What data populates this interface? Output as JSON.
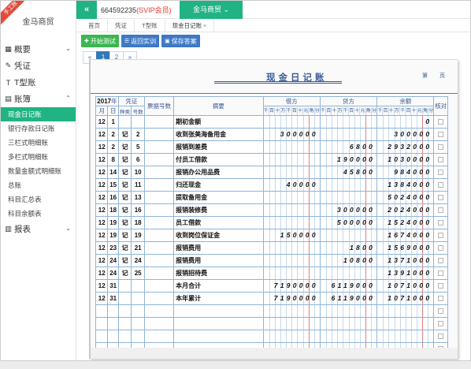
{
  "ribbon": "手工账",
  "sidebar": {
    "brand": "金马商贸",
    "groups": [
      {
        "label": "概要",
        "icon": "dashboard-icon"
      },
      {
        "label": "凭证",
        "icon": "pen-icon"
      },
      {
        "label": "T型账",
        "icon": "t-icon"
      },
      {
        "label": "账簿",
        "icon": "book-icon"
      }
    ],
    "items": [
      "现金日记账",
      "银行存款日记账",
      "三栏式明细账",
      "多栏式明细账",
      "数量金额式明细账",
      "总账",
      "科目汇总表",
      "科目余额表"
    ],
    "report": {
      "label": "报表",
      "icon": "table-icon"
    }
  },
  "topbar": {
    "collapse": "«",
    "user_id": "664592235",
    "vip": "(SVIP会员)",
    "company": "金马商贸"
  },
  "tabs": [
    {
      "label": "首页"
    },
    {
      "label": "凭证"
    },
    {
      "label": "T型账"
    },
    {
      "label": "现金日记账",
      "close": "×"
    }
  ],
  "toolbar": {
    "start": "开始测试",
    "back": "返回实训",
    "save": "保存答案"
  },
  "pager": {
    "prev": "«",
    "pages": [
      "1",
      "2"
    ],
    "next": "»"
  },
  "ledger": {
    "title": "现金日记账",
    "page_label_di": "第",
    "page_label_ye": "页",
    "header": {
      "year": "2017",
      "year_suffix": "年",
      "voucher": "凭证",
      "voucher_no": "票据号数",
      "summary": "摘要",
      "debit": "借方",
      "credit": "贷方",
      "balance": "余额",
      "check": "核对",
      "month": "月",
      "day": "日",
      "kind": "种类",
      "num": "号数",
      "digits": [
        "千",
        "百",
        "十",
        "万",
        "千",
        "百",
        "十",
        "元",
        "角",
        "分"
      ]
    },
    "rows": [
      {
        "m": "12",
        "d": "1",
        "k": "",
        "n": "",
        "summary": "期初金额",
        "debit": "",
        "credit": "",
        "balance": "0"
      },
      {
        "m": "12",
        "d": "2",
        "k": "记",
        "n": "2",
        "summary": "收到张美海备用金",
        "debit": "300000",
        "credit": "",
        "balance": "300000"
      },
      {
        "m": "12",
        "d": "2",
        "k": "记",
        "n": "5",
        "summary": "报销到差费",
        "debit": "",
        "credit": "6800",
        "balance": "2932000"
      },
      {
        "m": "12",
        "d": "8",
        "k": "记",
        "n": "6",
        "summary": "付员工借款",
        "debit": "",
        "credit": "190000",
        "balance": "1030000"
      },
      {
        "m": "12",
        "d": "14",
        "k": "记",
        "n": "10",
        "summary": "报销办公用品费",
        "debit": "",
        "credit": "45800",
        "balance": "984000"
      },
      {
        "m": "12",
        "d": "15",
        "k": "记",
        "n": "11",
        "summary": "归还现金",
        "debit": "40000",
        "credit": "",
        "balance": "1384000"
      },
      {
        "m": "12",
        "d": "16",
        "k": "记",
        "n": "13",
        "summary": "提取备用金",
        "debit": "",
        "credit": "",
        "balance": "5024000"
      },
      {
        "m": "12",
        "d": "18",
        "k": "记",
        "n": "16",
        "summary": "报销装修费",
        "debit": "",
        "credit": "300000",
        "balance": "2024000"
      },
      {
        "m": "12",
        "d": "19",
        "k": "记",
        "n": "18",
        "summary": "员工借款",
        "debit": "",
        "credit": "500000",
        "balance": "1524000"
      },
      {
        "m": "12",
        "d": "19",
        "k": "记",
        "n": "19",
        "summary": "收到岗位保证金",
        "debit": "150000",
        "credit": "",
        "balance": "1674000"
      },
      {
        "m": "12",
        "d": "23",
        "k": "记",
        "n": "21",
        "summary": "报销费用",
        "debit": "",
        "credit": "1800",
        "balance": "1569000"
      },
      {
        "m": "12",
        "d": "24",
        "k": "记",
        "n": "24",
        "summary": "报销费用",
        "debit": "",
        "credit": "10800",
        "balance": "1371000"
      },
      {
        "m": "12",
        "d": "24",
        "k": "记",
        "n": "25",
        "summary": "报销招待费",
        "debit": "",
        "credit": "",
        "balance": "1391000"
      },
      {
        "m": "12",
        "d": "31",
        "k": "",
        "n": "",
        "summary": "本月合计",
        "debit": "7190000",
        "credit": "6119000",
        "balance": "1071000"
      },
      {
        "m": "12",
        "d": "31",
        "k": "",
        "n": "",
        "summary": "本年累计",
        "debit": "7190000",
        "credit": "6119000",
        "balance": "1071000"
      },
      {
        "m": "",
        "d": "",
        "k": "",
        "n": "",
        "summary": "",
        "debit": "",
        "credit": "",
        "balance": ""
      },
      {
        "m": "",
        "d": "",
        "k": "",
        "n": "",
        "summary": "",
        "debit": "",
        "credit": "",
        "balance": ""
      },
      {
        "m": "",
        "d": "",
        "k": "",
        "n": "",
        "summary": "",
        "debit": "",
        "credit": "",
        "balance": ""
      },
      {
        "m": "",
        "d": "",
        "k": "",
        "n": "",
        "summary": "",
        "debit": "",
        "credit": "",
        "balance": ""
      }
    ]
  },
  "colors": {
    "accent": "#21b384",
    "vip": "#e23b2e",
    "ledger_blue": "#3a5a95",
    "ledger_red": "#d9464a"
  }
}
